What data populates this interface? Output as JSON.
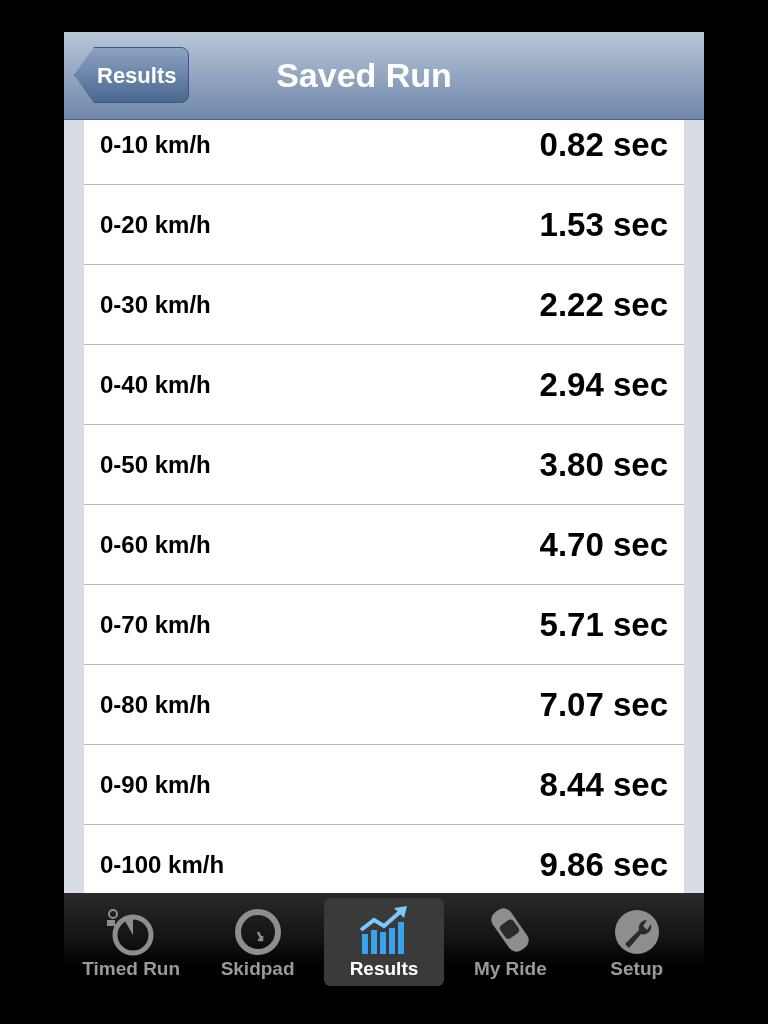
{
  "nav_bar": {
    "back_button": "Results",
    "title": "Saved Run"
  },
  "rows": [
    {
      "label": "0-10 km/h",
      "value": "0.82 sec"
    },
    {
      "label": "0-20 km/h",
      "value": "1.53 sec"
    },
    {
      "label": "0-30 km/h",
      "value": "2.22 sec"
    },
    {
      "label": "0-40 km/h",
      "value": "2.94 sec"
    },
    {
      "label": "0-50 km/h",
      "value": "3.80 sec"
    },
    {
      "label": "0-60 km/h",
      "value": "4.70 sec"
    },
    {
      "label": "0-70 km/h",
      "value": "5.71 sec"
    },
    {
      "label": "0-80 km/h",
      "value": "7.07 sec"
    },
    {
      "label": "0-90 km/h",
      "value": "8.44 sec"
    },
    {
      "label": "0-100 km/h",
      "value": "9.86 sec"
    }
  ],
  "tab_bar": [
    {
      "label": "Timed Run",
      "kind": "stopwatch",
      "selected": false
    },
    {
      "label": "Skidpad",
      "kind": "gauge",
      "selected": false
    },
    {
      "label": "Results",
      "kind": "chart",
      "selected": true
    },
    {
      "label": "My Ride",
      "kind": "car",
      "selected": false
    },
    {
      "label": "Setup",
      "kind": "wrench",
      "selected": false
    }
  ]
}
